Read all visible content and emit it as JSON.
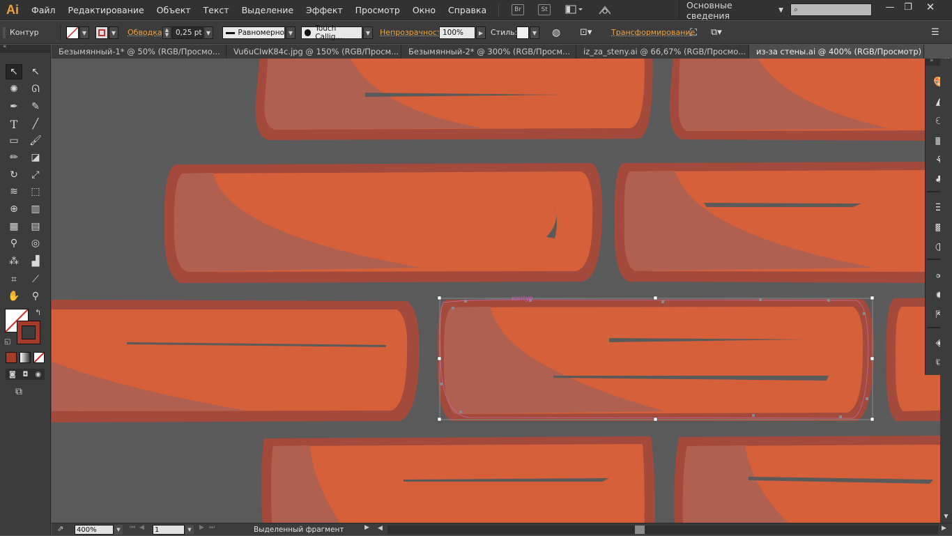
{
  "app": {
    "logo": "Ai"
  },
  "menu": [
    "Файл",
    "Редактирование",
    "Объект",
    "Текст",
    "Выделение",
    "Эффект",
    "Просмотр",
    "Окно",
    "Справка"
  ],
  "menubar_icons": {
    "bridge": "Br",
    "stock": "St"
  },
  "workspace": {
    "label": "Основные сведения"
  },
  "search": {
    "placeholder": ""
  },
  "control": {
    "selection_label": "Контур",
    "stroke_label": "Обводка:",
    "stroke_weight": "0,25 pt",
    "profile_label": "Равномерно",
    "brush_label": "Touch Callig...",
    "opacity_label": "Непрозрачность:",
    "opacity_value": "100%",
    "style_label": "Стиль:",
    "transform_label": "Трансформирование"
  },
  "tabs": [
    {
      "label": "Безымянный-1* @ 50% (RGB/Просмо...",
      "active": false
    },
    {
      "label": "Vu6uCIwK84c.jpg @ 150% (RGB/Просм...",
      "active": false
    },
    {
      "label": "Безымянный-2* @ 300% (RGB/Просм...",
      "active": false
    },
    {
      "label": "iz_za_steny.ai @ 66,67% (RGB/Просмо...",
      "active": false
    },
    {
      "label": "из-за стены.ai @ 400% (RGB/Просмотр)",
      "active": true
    }
  ],
  "canvas": {
    "selection_label": "контур",
    "colors": {
      "bg": "#5a5a5a",
      "brick_outer": "#a34a3c",
      "brick_fill": "#d6603a",
      "brick_shade": "#b06050",
      "line": "#5a5a5a",
      "selection": "#c06a9e"
    }
  },
  "status": {
    "zoom": "400%",
    "artboard": "1",
    "tool_label": "Выделенный фрагмент"
  },
  "icons": {
    "tools": [
      "selection-icon",
      "direct-selection-icon",
      "magic-wand-icon",
      "lasso-icon",
      "pen-icon",
      "curvature-icon",
      "type-icon",
      "line-icon",
      "rectangle-icon",
      "paintbrush-icon",
      "pencil-icon",
      "eraser-icon",
      "rotate-icon",
      "scale-icon",
      "warp-icon",
      "free-transform-icon",
      "shape-builder-icon",
      "perspective-icon",
      "mesh-icon",
      "gradient-icon",
      "eyedropper-icon",
      "blend-icon",
      "symbol-sprayer-icon",
      "column-graph-icon",
      "artboard-icon",
      "slice-icon",
      "hand-icon",
      "zoom-icon"
    ],
    "right_panel": [
      "color-panel-icon",
      "color-guide-icon",
      "appearance-icon",
      "swatches-icon",
      "brushes-icon",
      "symbols-icon",
      "stroke-icon",
      "gradient-panel-icon",
      "transparency-icon",
      "cc-libraries-icon",
      "graphic-styles-icon",
      "asset-export-icon",
      "layers-icon",
      "artboards-panel-icon"
    ]
  }
}
